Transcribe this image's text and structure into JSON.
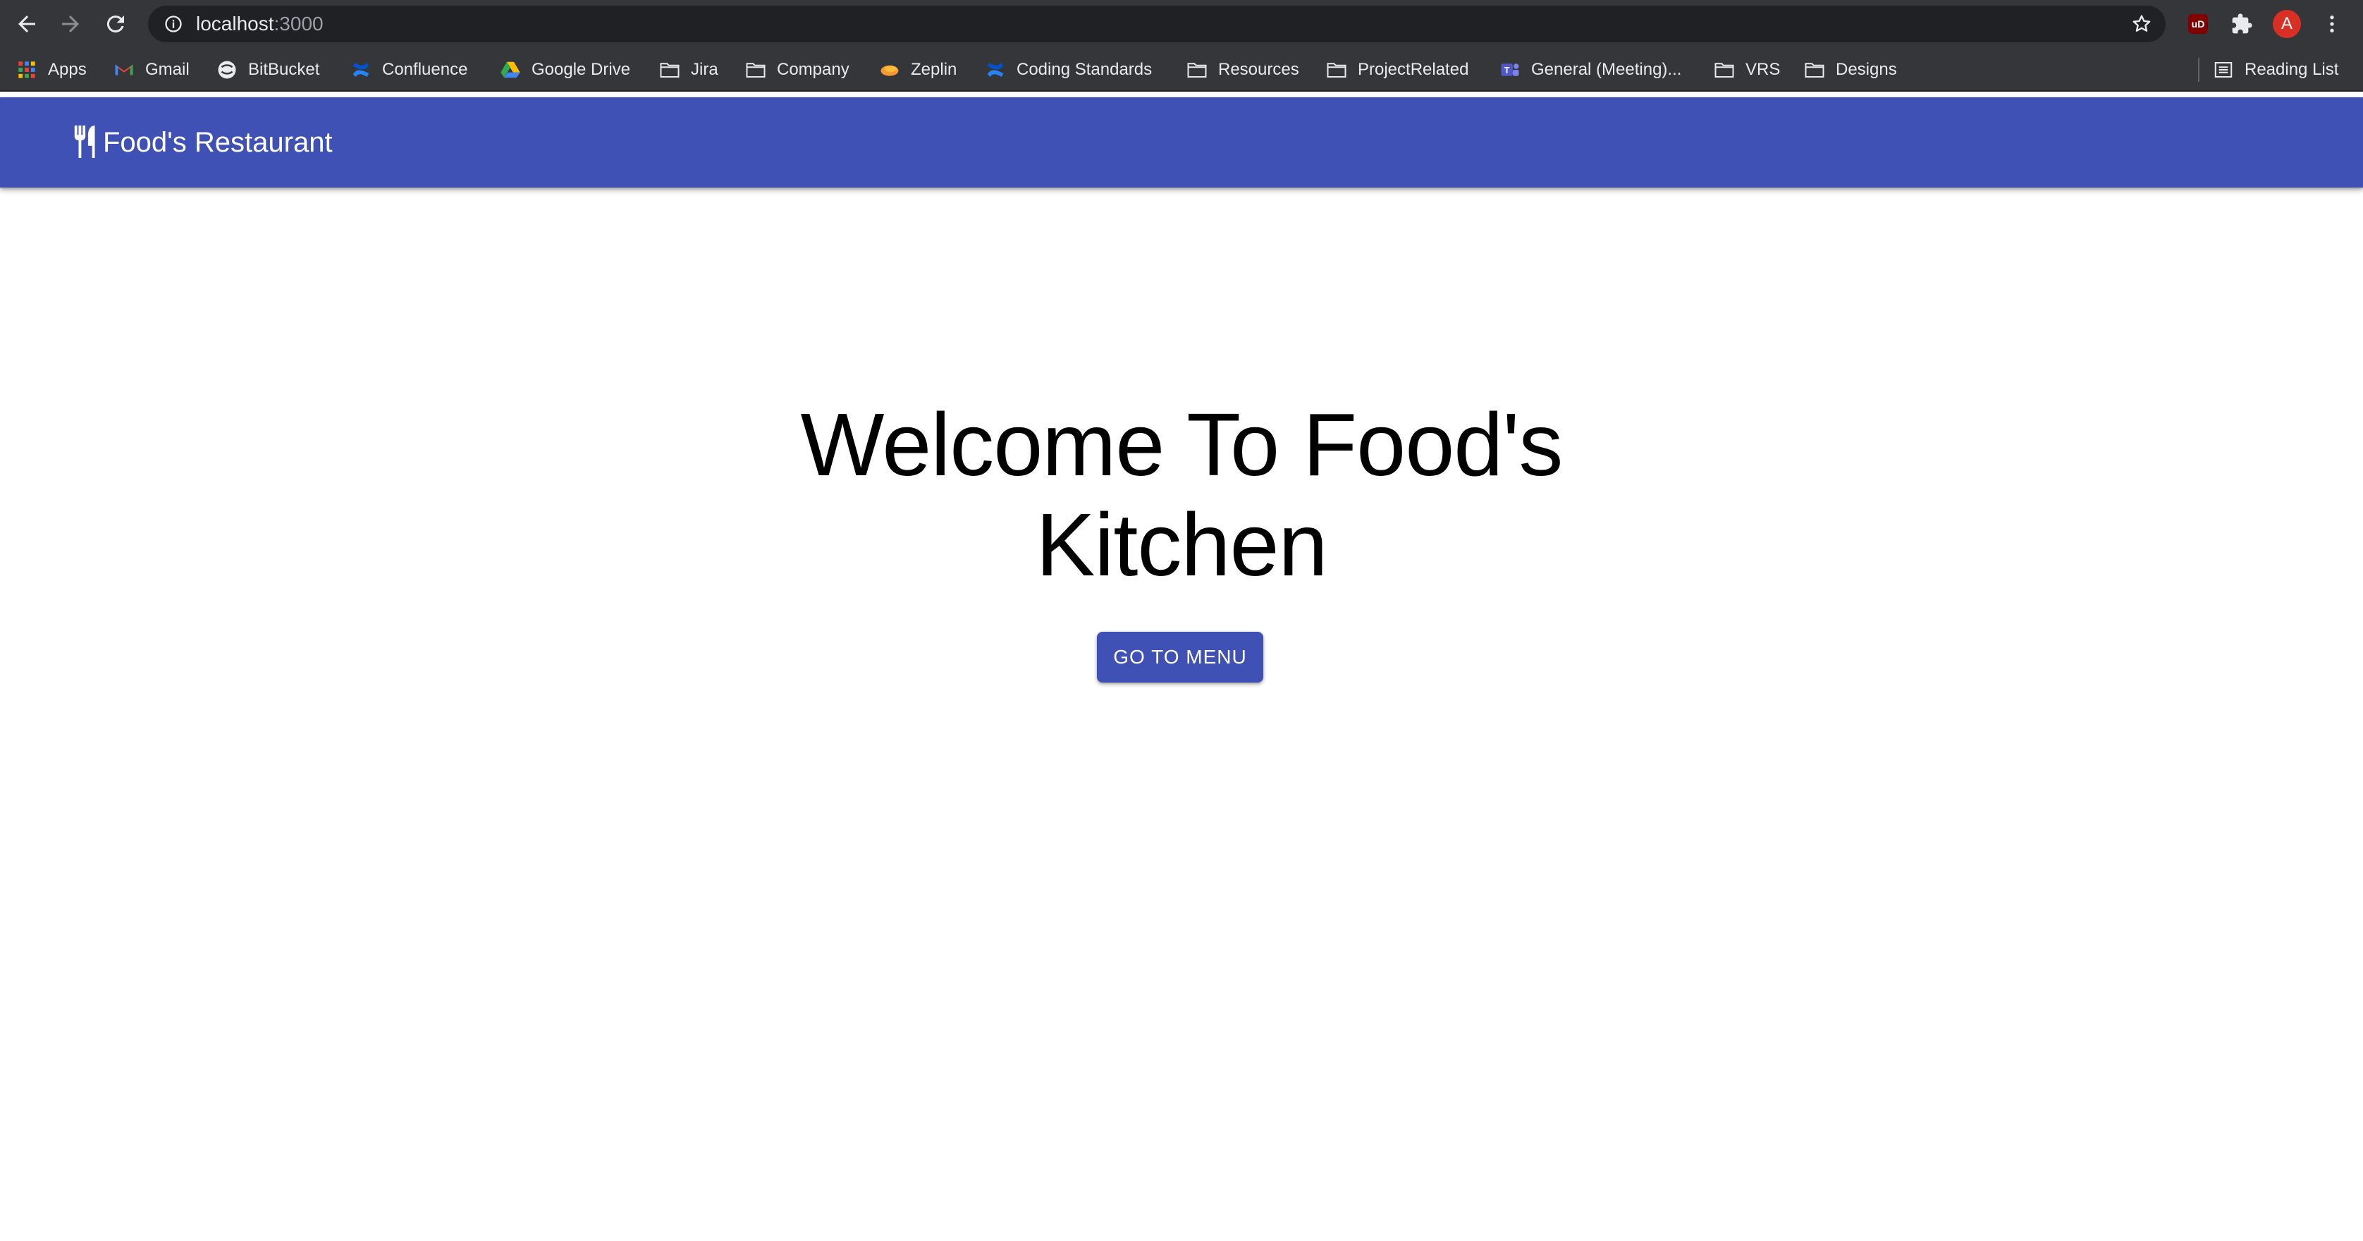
{
  "browser": {
    "url_host": "localhost",
    "url_port": ":3000",
    "bookmarks": [
      {
        "label": "Apps",
        "icon": "apps-grid-icon"
      },
      {
        "label": "Gmail",
        "icon": "gmail-icon"
      },
      {
        "label": "BitBucket",
        "icon": "bitbucket-icon"
      },
      {
        "label": "Confluence",
        "icon": "confluence-icon"
      },
      {
        "label": "Google Drive",
        "icon": "google-drive-icon"
      },
      {
        "label": "Jira",
        "icon": "folder-icon"
      },
      {
        "label": "Company",
        "icon": "folder-icon"
      },
      {
        "label": "Zeplin",
        "icon": "zeplin-icon"
      },
      {
        "label": "Coding Standards",
        "icon": "confluence-icon"
      },
      {
        "label": "Resources",
        "icon": "folder-icon"
      },
      {
        "label": "ProjectRelated",
        "icon": "folder-icon"
      },
      {
        "label": "General (Meeting)...",
        "icon": "teams-icon"
      },
      {
        "label": "VRS",
        "icon": "folder-icon"
      },
      {
        "label": "Designs",
        "icon": "folder-icon"
      }
    ],
    "reading_list": "Reading List",
    "avatar_letter": "A",
    "ublock_label": "uD"
  },
  "app": {
    "title": "Food's Restaurant",
    "logo_icon": "restaurant-icon",
    "accent_color": "#3f51b5"
  },
  "hero": {
    "heading": "Welcome To Food's Kitchen",
    "button_label": "GO TO MENU"
  }
}
